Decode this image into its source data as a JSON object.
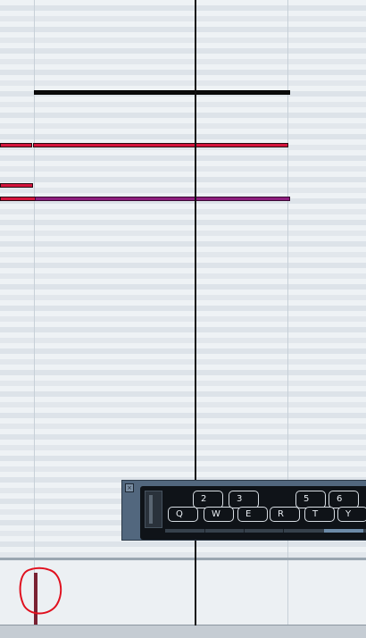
{
  "virtual_keyboard": {
    "close_glyph": "×",
    "upper_keys": [
      "2",
      "3",
      "5",
      "6"
    ],
    "lower_keys": [
      "Q",
      "W",
      "E",
      "R",
      "T",
      "Y"
    ]
  },
  "colors": {
    "note_black": "#0c0c0c",
    "note_red": "#d4143c",
    "note_purple": "#8d1f7e",
    "velocity_bar": "#7a2233",
    "annotation_circle": "#e0101e"
  }
}
